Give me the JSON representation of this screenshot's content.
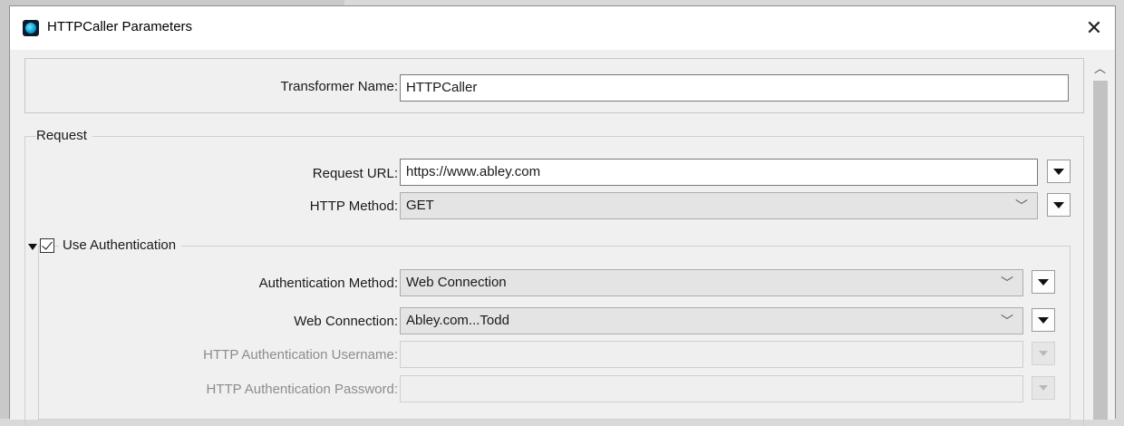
{
  "window": {
    "title": "HTTPCaller Parameters",
    "close_glyph": "✕"
  },
  "transformer": {
    "name_label": "Transformer Name:",
    "name_value": "HTTPCaller"
  },
  "request": {
    "group_title": "Request",
    "url_label": "Request URL:",
    "url_value": "https://www.abley.com",
    "method_label": "HTTP Method:",
    "method_value": "GET"
  },
  "authentication": {
    "group_title": "Use Authentication",
    "checked": true,
    "method_label": "Authentication Method:",
    "method_value": "Web Connection",
    "web_connection_label": "Web Connection:",
    "web_connection_value": "Abley.com...Todd",
    "username_label": "HTTP Authentication Username:",
    "username_value": "",
    "password_label": "HTTP Authentication Password:",
    "password_value": ""
  },
  "icons": {
    "app": "httpcaller-app-icon",
    "close": "close-icon",
    "dropdown": "chevron-down-icon",
    "menu": "triangle-menu-icon",
    "collapse": "collapse-triangle-icon",
    "scroll_up": "chevron-up-icon"
  }
}
